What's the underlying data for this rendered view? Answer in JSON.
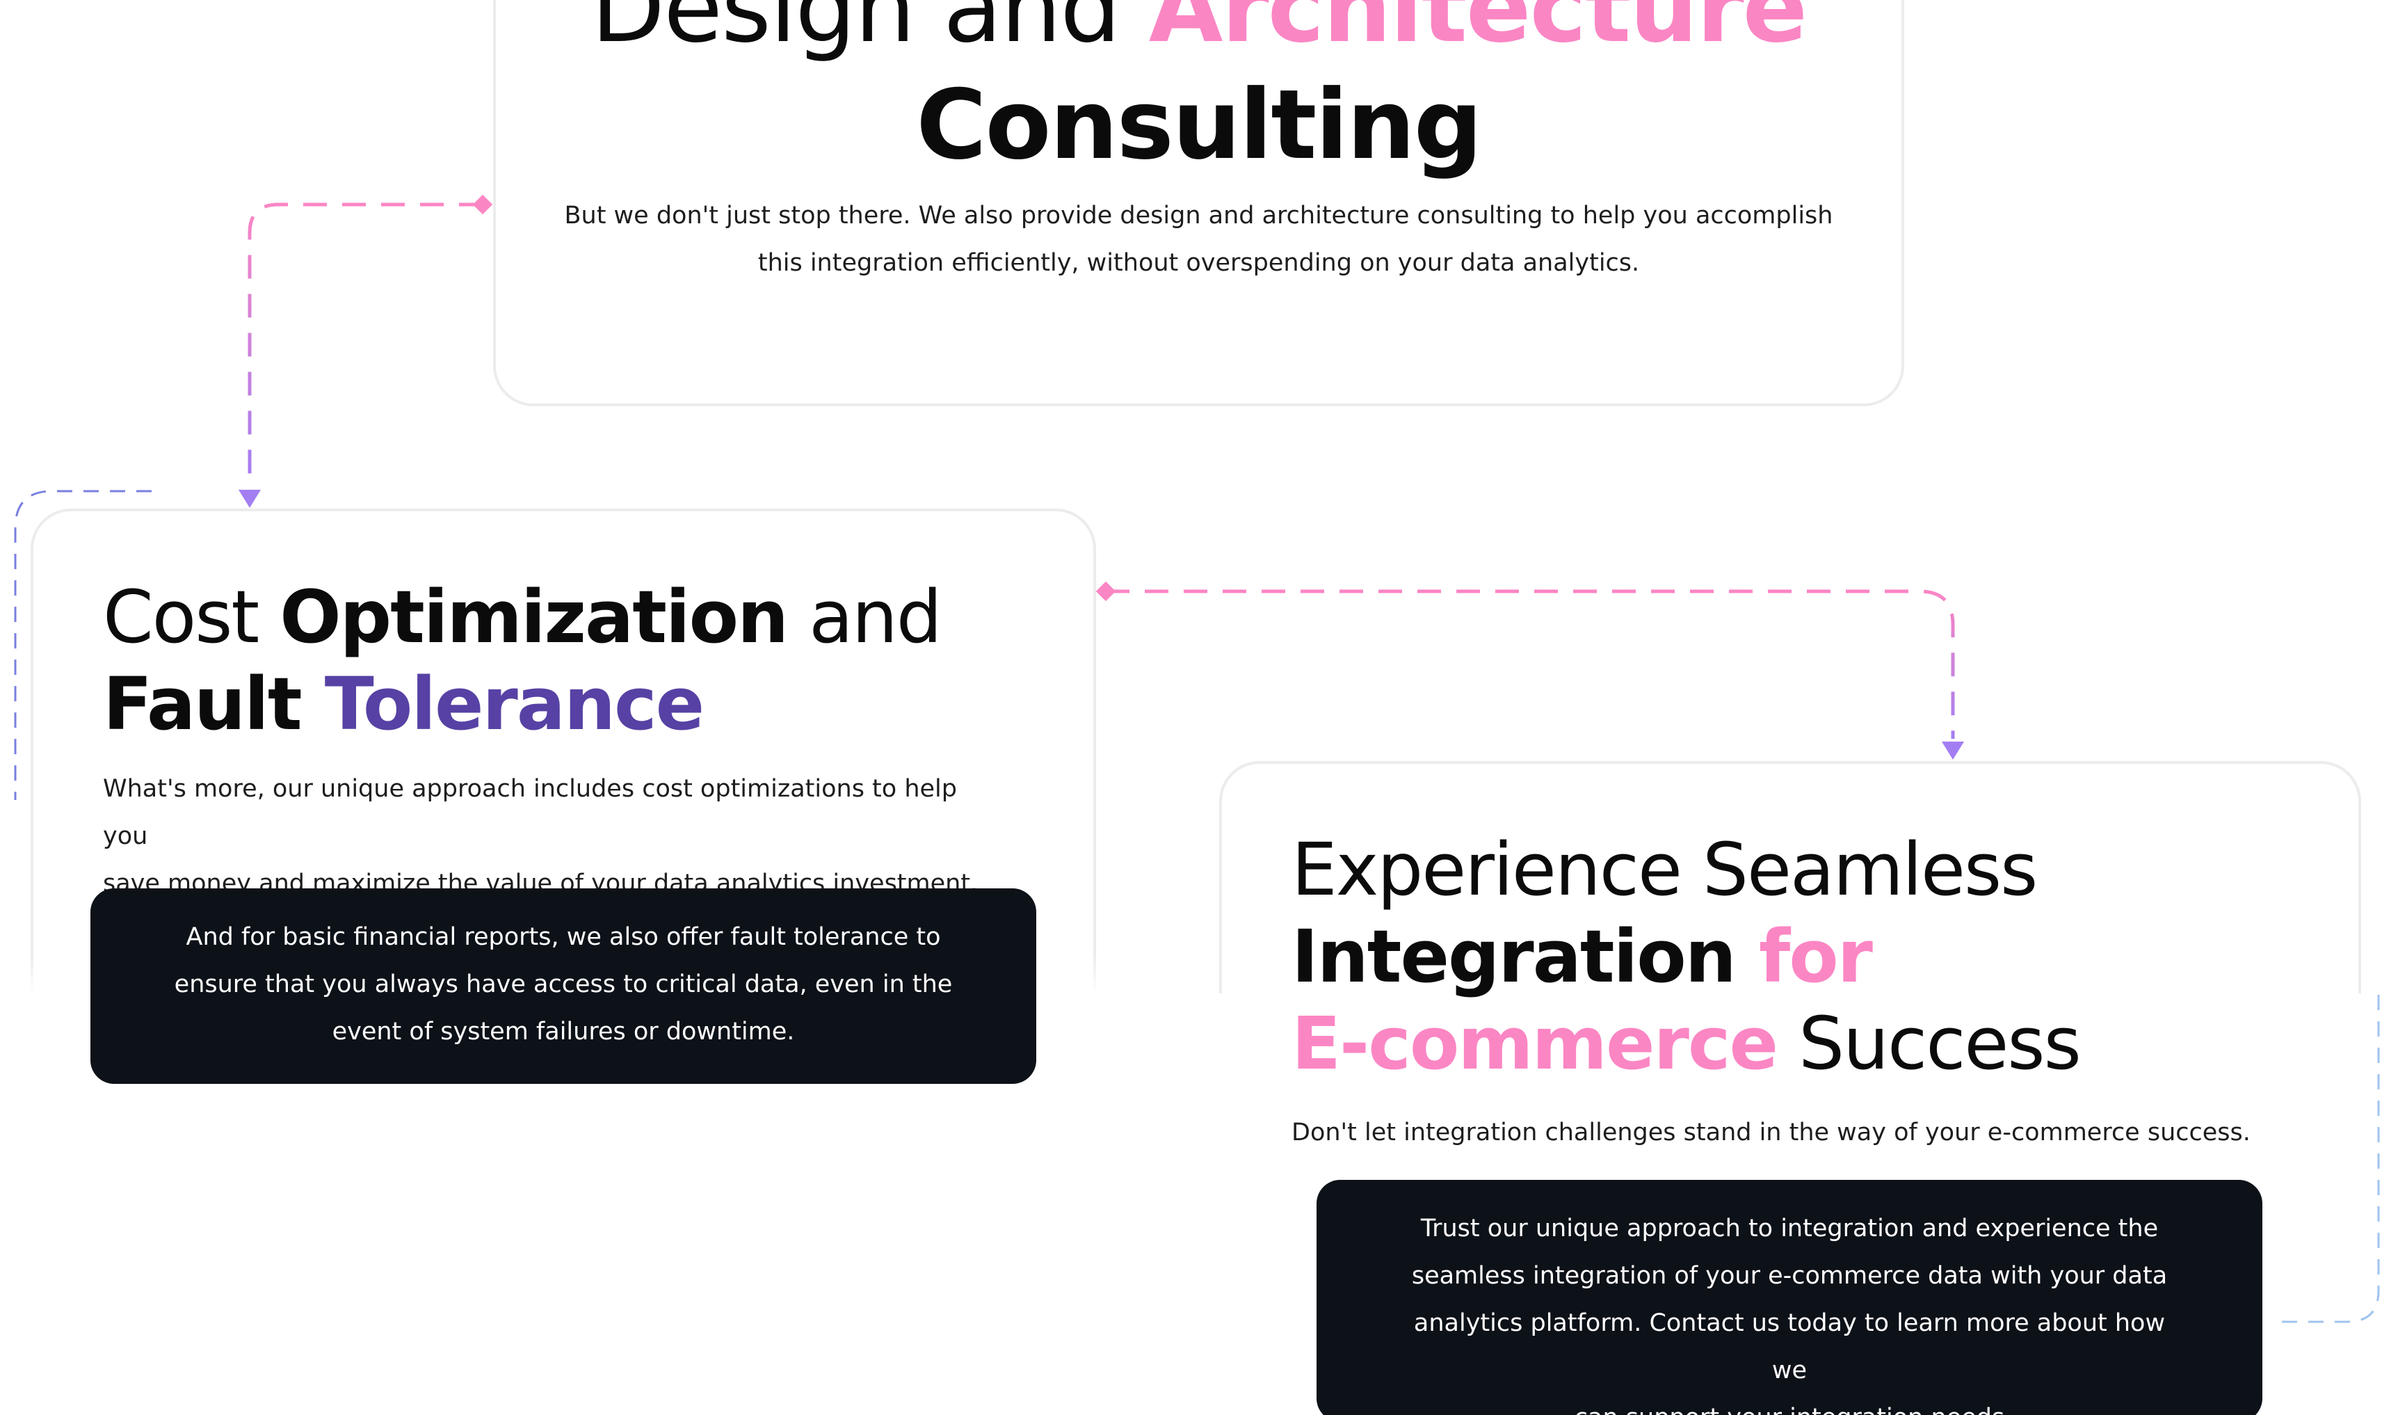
{
  "theme": {
    "accent_pink": "#fb86c4",
    "accent_purple": "#5741a4",
    "connector_purple": "#a37ef3",
    "connector_blue": "#9fc4ef",
    "dark_box": "#0d1118"
  },
  "top_card": {
    "title_part1": "Design and ",
    "title_part2": "Architecture",
    "title_line2": "Consulting",
    "body_line1": "But we don't just stop there. We also provide design and architecture consulting to help you accomplish",
    "body_line2": "this integration efficiently, without overspending on your data analytics."
  },
  "left_card": {
    "title_part1": "Cost ",
    "title_part2": "Optimization",
    "title_part3": " and",
    "title_part4": "Fault ",
    "title_part5": "Tolerance",
    "body_line1": "What's more, our unique approach includes cost optimizations to help you",
    "body_line2": "save money and maximize the value of your data analytics investment.",
    "callout_line1": "And for basic financial reports, we also offer fault tolerance to",
    "callout_line2": "ensure that you always have access to critical data, even in the",
    "callout_line3": "event of system failures or downtime."
  },
  "right_card": {
    "title_line1": "Experience Seamless",
    "title_part2": "Integration ",
    "title_part3": "for",
    "title_part4": "E-commerce",
    "title_part5": " Success",
    "body": "Don't let integration challenges stand in the way of your e-commerce success.",
    "callout_line1": "Trust our unique approach to integration and experience the",
    "callout_line2": "seamless integration of your e-commerce data with your data",
    "callout_line3": "analytics platform. Contact us today to learn more about how we",
    "callout_line4": "can support your integration needs"
  }
}
